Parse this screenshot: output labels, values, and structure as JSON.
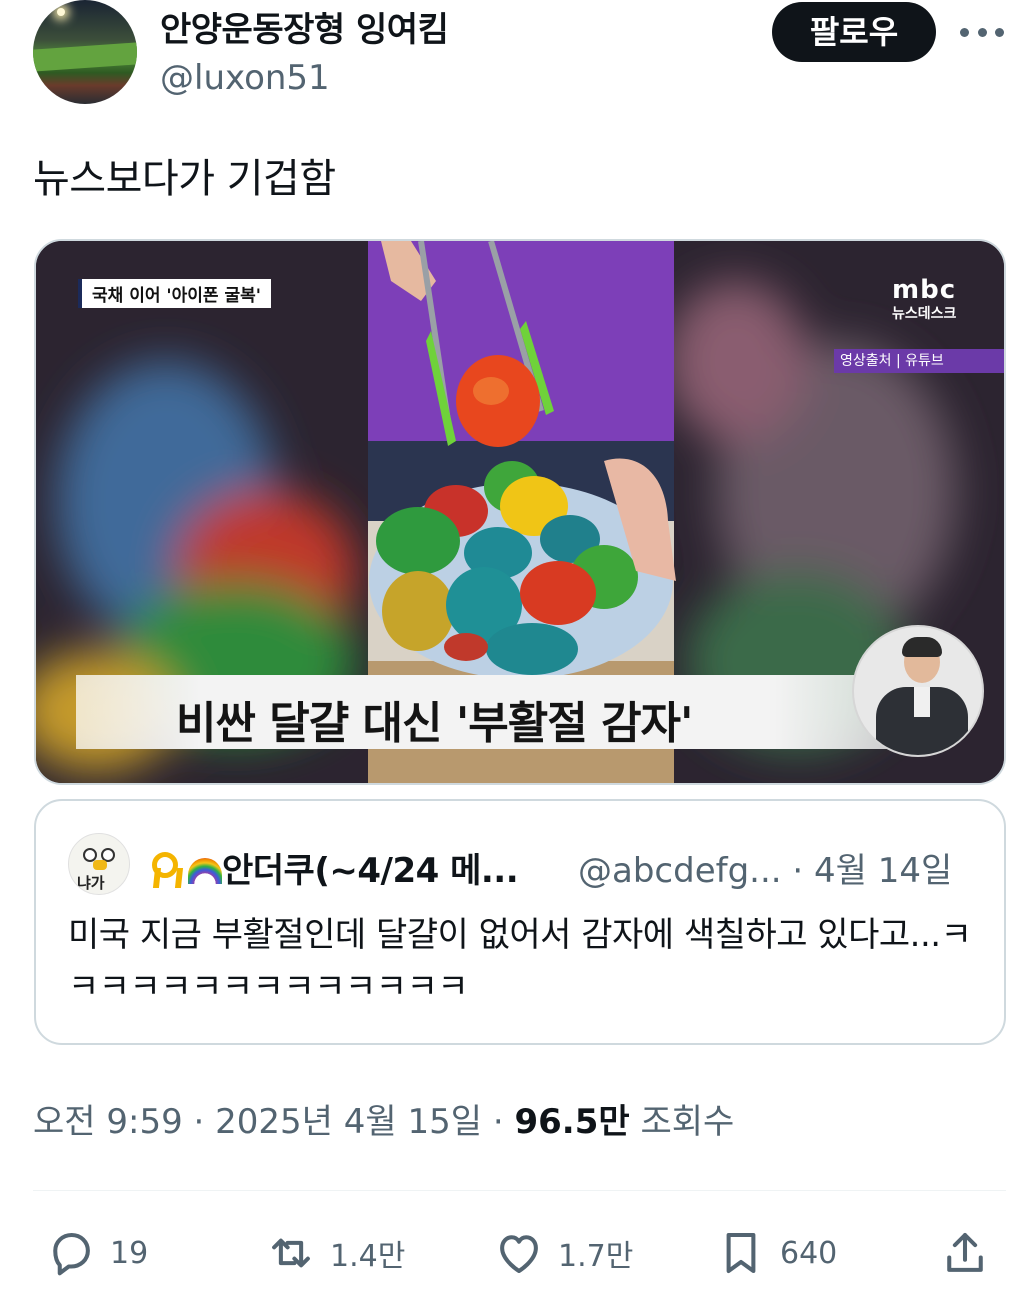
{
  "author": {
    "display_name": "안양운동장형 잉여킴",
    "handle": "@luxon51",
    "follow_label": "팔로우"
  },
  "post": {
    "text": "뉴스보다가 기겁함"
  },
  "media": {
    "news_topline": "국채 이어 '아이폰 굴복'",
    "logo": "mbc",
    "logo_sub": "뉴스데스크",
    "source": "영상출처 | 유튜브",
    "caption": "비싼 달걀 대신 '부활절 감자'"
  },
  "quoted": {
    "avatar_tag": "냐가",
    "name": "안더쿠(~4/24 메...",
    "handle": "@abcdefg...",
    "date": "· 4월 14일",
    "text": "미국 지금 부활절인데 달걀이 없어서 감자에 색칠하고 있다고...ㅋㅋㅋㅋㅋㅋㅋㅋㅋㅋㅋㅋㅋㅋ"
  },
  "meta": {
    "time": "오전 9:59",
    "date": "2025년 4월 15일",
    "views_count": "96.5만",
    "views_label": "조회수"
  },
  "actions": {
    "replies": "19",
    "reposts": "1.4만",
    "likes": "1.7만",
    "bookmarks": "640"
  }
}
